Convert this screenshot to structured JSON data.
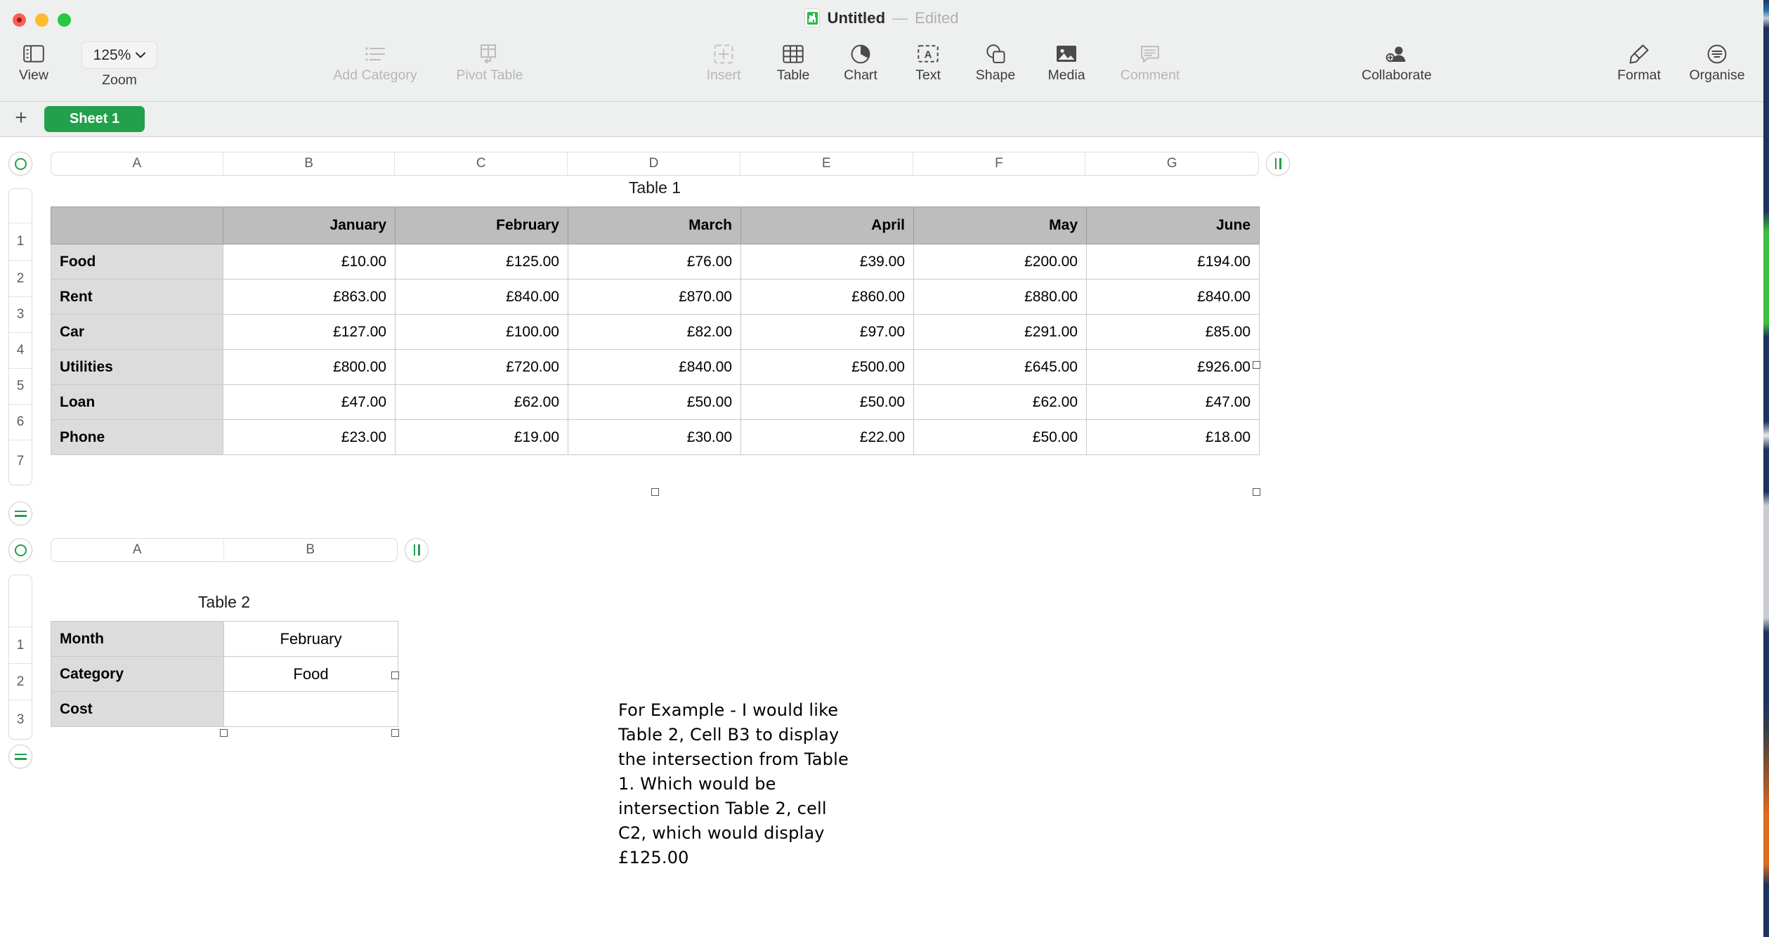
{
  "window": {
    "title_name": "Untitled",
    "title_dash": "—",
    "title_state": "Edited",
    "app_icon": "numbers-document-icon"
  },
  "toolbar": {
    "view": {
      "label": "View",
      "icon": "sidebar-icon"
    },
    "zoom": {
      "label": "Zoom",
      "value": "125%",
      "icon": "chevron-down-icon"
    },
    "add_category": {
      "label": "Add Category",
      "icon": "list-bullet-icon",
      "enabled": false
    },
    "pivot_table": {
      "label": "Pivot Table",
      "icon": "pivot-table-icon",
      "enabled": false
    },
    "insert": {
      "label": "Insert",
      "icon": "insert-plus-icon",
      "enabled": false
    },
    "table": {
      "label": "Table",
      "icon": "table-grid-icon",
      "enabled": true
    },
    "chart": {
      "label": "Chart",
      "icon": "pie-chart-icon",
      "enabled": true
    },
    "text": {
      "label": "Text",
      "icon": "text-box-icon",
      "enabled": true
    },
    "shape": {
      "label": "Shape",
      "icon": "shapes-icon",
      "enabled": true
    },
    "media": {
      "label": "Media",
      "icon": "photo-icon",
      "enabled": true
    },
    "comment": {
      "label": "Comment",
      "icon": "comment-bubble-icon",
      "enabled": false
    },
    "collaborate": {
      "label": "Collaborate",
      "icon": "add-person-icon",
      "enabled": true
    },
    "format": {
      "label": "Format",
      "icon": "paintbrush-icon",
      "enabled": true
    },
    "organise": {
      "label": "Organise",
      "icon": "organise-lines-icon",
      "enabled": true
    }
  },
  "sheetbar": {
    "add_sheet": "+",
    "tabs": [
      {
        "label": "Sheet 1",
        "active": true
      }
    ]
  },
  "table1": {
    "title": "Table 1",
    "column_headers": [
      "A",
      "B",
      "C",
      "D",
      "E",
      "F",
      "G"
    ],
    "row_numbers": [
      "1",
      "2",
      "3",
      "4",
      "5",
      "6",
      "7"
    ],
    "header_row": [
      "",
      "January",
      "February",
      "March",
      "April",
      "May",
      "June"
    ],
    "rows": [
      {
        "label": "Food",
        "values": [
          "£10.00",
          "£125.00",
          "£76.00",
          "£39.00",
          "£200.00",
          "£194.00"
        ]
      },
      {
        "label": "Rent",
        "values": [
          "£863.00",
          "£840.00",
          "£870.00",
          "£860.00",
          "£880.00",
          "£840.00"
        ]
      },
      {
        "label": "Car",
        "values": [
          "£127.00",
          "£100.00",
          "£82.00",
          "£97.00",
          "£291.00",
          "£85.00"
        ]
      },
      {
        "label": "Utilities",
        "values": [
          "£800.00",
          "£720.00",
          "£840.00",
          "£500.00",
          "£645.00",
          "£926.00"
        ]
      },
      {
        "label": "Loan",
        "values": [
          "£47.00",
          "£62.00",
          "£50.00",
          "£50.00",
          "£62.00",
          "£47.00"
        ]
      },
      {
        "label": "Phone",
        "values": [
          "£23.00",
          "£19.00",
          "£30.00",
          "£22.00",
          "£50.00",
          "£18.00"
        ]
      }
    ]
  },
  "table2": {
    "title": "Table 2",
    "column_headers": [
      "A",
      "B"
    ],
    "row_numbers": [
      "1",
      "2",
      "3"
    ],
    "rows": [
      {
        "label": "Month",
        "value": "February"
      },
      {
        "label": "Category",
        "value": "Food"
      },
      {
        "label": "Cost",
        "value": ""
      }
    ]
  },
  "annotation": {
    "text": "For Example - I would like Table 2, Cell B3 to display the intersection from Table 1. Which would be intersection Table 2, cell C2, which would display £125.00"
  },
  "colors": {
    "accent_green": "#23a04b",
    "tab_green": "#23a04b",
    "toolbar_bg": "#eef0ef",
    "header_cell": "#bdbdbd",
    "row_label_cell": "#dcdcdc"
  }
}
